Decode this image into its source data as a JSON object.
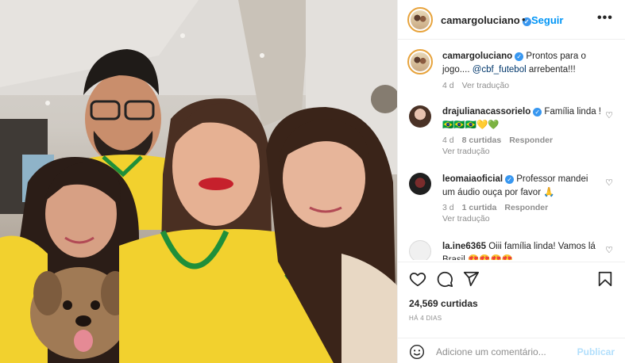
{
  "post": {
    "author": "camargoluciano",
    "follow_label": "Seguir",
    "separator": "•",
    "more_label": "•••",
    "caption_prefix": "Prontos para o jogo.... ",
    "caption_mention": "@cbf_futebol",
    "caption_suffix": " arrebenta!!!",
    "caption_age": "4 d",
    "see_translation": "Ver tradução"
  },
  "comments": [
    {
      "user": "drajulianacassorielo",
      "text": "Família linda !🇧🇷🇧🇷🇧🇷💛💚",
      "age": "4 d",
      "likes": "8 curtidas",
      "reply": "Responder",
      "translate": "Ver tradução"
    },
    {
      "user": "leomaiaoficial",
      "text": "Professor mandei um áudio ouça por favor 🙏",
      "age": "3 d",
      "likes": "1 curtida",
      "reply": "Responder",
      "translate": "Ver tradução"
    },
    {
      "user": "la.ine6365",
      "text": "Oiii família linda! Vamos lá Brasil 😍😍😍😍"
    }
  ],
  "stats": {
    "likes": "24,569 curtidas",
    "time_ago": "HÁ 4 DIAS"
  },
  "composer": {
    "placeholder": "Adicione um comentário...",
    "publish": "Publicar"
  },
  "icons": {
    "heart": "heart-icon",
    "comment": "comment-icon",
    "share": "share-icon",
    "save": "bookmark-icon",
    "emoji": "emoji-icon"
  },
  "colors": {
    "link": "#0095f6",
    "verified": "#3897f0",
    "muted": "#8e8e8e",
    "jersey_yellow": "#f2d12e",
    "jersey_green": "#1f8f3a"
  }
}
